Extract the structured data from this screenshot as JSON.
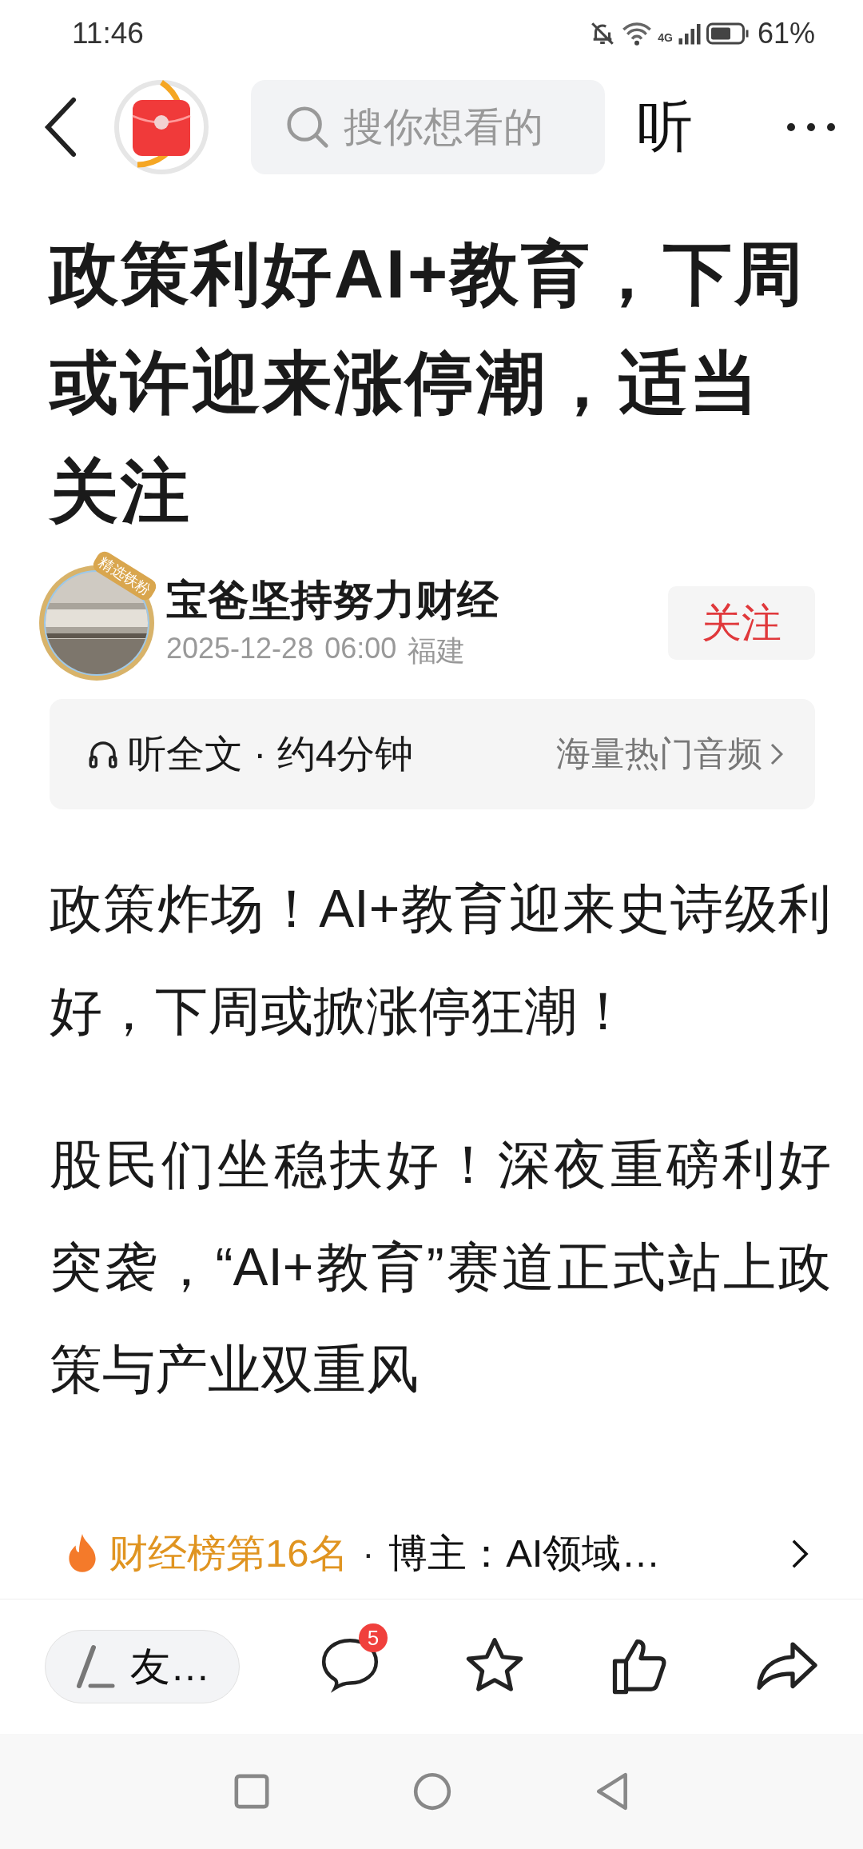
{
  "status_bar": {
    "time": "11:46",
    "network": "4G",
    "battery": "61%"
  },
  "header": {
    "search": {
      "placeholder": "搜你想看的"
    },
    "listen_button": "听"
  },
  "article": {
    "title": "政策利好AI+教育，下周或许迎来涨停潮，适当关注",
    "author": {
      "name": "宝爸坚持努力财经",
      "badge": "精选铁粉",
      "date": "2025-12-28",
      "time": "06:00",
      "location": "福建",
      "follow_button": "关注"
    },
    "listen_bar": {
      "label": "听全文 · 约4分钟",
      "link": "海量热门音频"
    },
    "paragraphs": [
      "政策炸场！AI+教育迎来史诗级利好，下周或掀涨停狂潮！",
      "股民们坐稳扶好！深夜重磅利好突袭，“AI+教育”赛道正式站上政策与产业双重风"
    ]
  },
  "rank_bar": {
    "rank": "财经榜第16名",
    "separator": "·",
    "info": "博主：AI领域…"
  },
  "toolbar": {
    "comment_field": {
      "placeholder": "友…"
    },
    "comment_count": "5"
  }
}
